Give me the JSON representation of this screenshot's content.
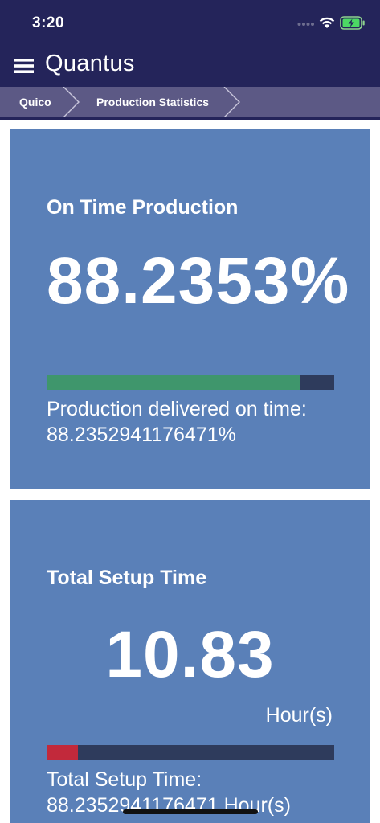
{
  "status_bar": {
    "time": "3:20"
  },
  "header": {
    "app_title": "Quantus"
  },
  "breadcrumb": {
    "items": [
      {
        "label": "Quico"
      },
      {
        "label": "Production Statistics"
      }
    ]
  },
  "cards": [
    {
      "title": "On Time Production",
      "value": "88.2353%",
      "unit": "",
      "progress_fraction": 0.882,
      "progress_color": "#3f966c",
      "description_line1": "Production delivered on time:",
      "description_line2": "88.2352941176471%"
    },
    {
      "title": "Total Setup Time",
      "value": "10.83",
      "unit": "Hour(s)",
      "progress_fraction": 0.108,
      "progress_color": "#c2293b",
      "description_line1": "Total Setup Time:",
      "description_line2": "88.2352941176471 Hour(s)"
    }
  ],
  "colors": {
    "header_bg": "#24245a",
    "breadcrumb_bg": "#5c5985",
    "card_bg": "#5a80b8",
    "track_bg": "#2e3b5c"
  },
  "icons": {
    "menu": "hamburger-menu-icon",
    "wifi": "wifi-icon",
    "battery": "battery-charging-icon",
    "breadcrumb_separator": "chevron-right-icon"
  }
}
